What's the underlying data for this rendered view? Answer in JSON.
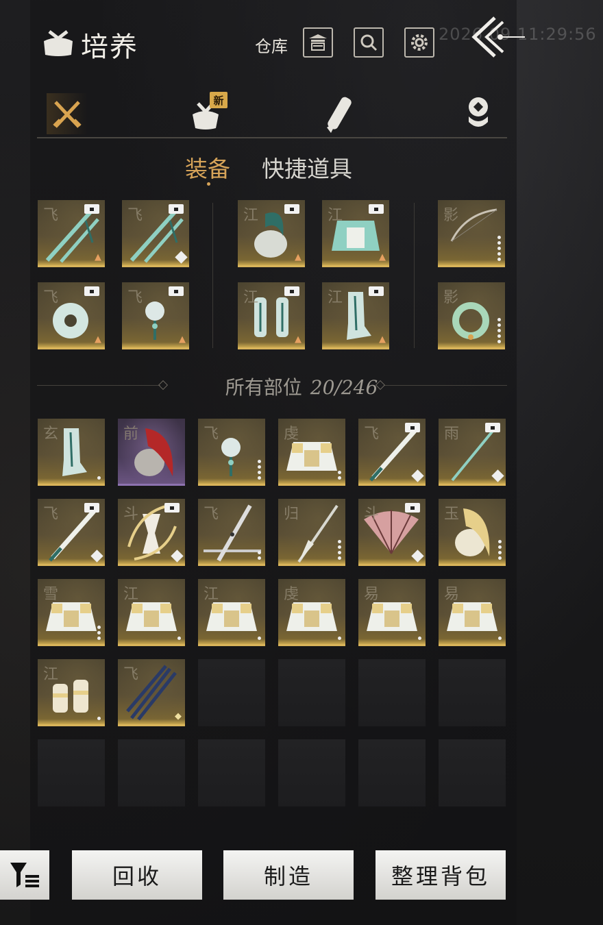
{
  "header": {
    "title": "培养",
    "warehouse_label": "仓库",
    "clock": "2026 09 11:29:56",
    "icons": [
      "bundle-icon",
      "warehouse-icon",
      "search-icon",
      "gear-icon",
      "back-arrow-icon"
    ]
  },
  "category_tabs": [
    {
      "icon": "crossed-swords-icon",
      "selected": true
    },
    {
      "icon": "bundle-icon",
      "badge": "新"
    },
    {
      "icon": "scroll-icon"
    },
    {
      "icon": "coin-stack-icon"
    }
  ],
  "sub_tabs": {
    "equipment": "装备",
    "quick_items": "快捷道具"
  },
  "equipped": [
    {
      "char": "飞",
      "item": "twin-jade-swords",
      "arrow": true
    },
    {
      "char": "飞",
      "item": "twin-jade-swords",
      "gem": true
    },
    {
      "char": "江",
      "item": "plumed-helmet",
      "arrow": true
    },
    {
      "char": "江",
      "item": "jade-chestplate",
      "arrow": true
    },
    {
      "char": "影",
      "item": "bow",
      "dots": 5
    },
    {
      "char": "飞",
      "item": "jade-disc",
      "arrow": true
    },
    {
      "char": "飞",
      "item": "jade-pendant",
      "arrow": true
    },
    {
      "char": "江",
      "item": "leg-guards",
      "arrow": true
    },
    {
      "char": "江",
      "item": "greaves",
      "arrow": true
    },
    {
      "char": "影",
      "item": "jade-ring",
      "dots": 5
    }
  ],
  "inventory": {
    "label": "所有部位",
    "count": "20/246",
    "items": [
      {
        "char": "玄",
        "item": "greaves",
        "dots": 1
      },
      {
        "char": "前",
        "item": "red-plume-helmet",
        "rarity": "purple"
      },
      {
        "char": "飞",
        "item": "jade-pendant",
        "dots": 4
      },
      {
        "char": "虔",
        "item": "gold-armor",
        "dots": 2
      },
      {
        "char": "飞",
        "item": "jade-sword",
        "gem": true
      },
      {
        "char": "雨",
        "item": "jade-spear",
        "gem": true
      },
      {
        "char": "飞",
        "item": "jade-sword",
        "gem": true
      },
      {
        "char": "斗",
        "item": "drum-weapon",
        "gem": true
      },
      {
        "char": "飞",
        "item": "spear-staff",
        "dots": 2
      },
      {
        "char": "归",
        "item": "glaive",
        "dots": 4
      },
      {
        "char": "斗",
        "item": "folding-fan",
        "gem": true
      },
      {
        "char": "玉",
        "item": "gold-plume-helmet",
        "dots": 4
      },
      {
        "char": "雪",
        "item": "gold-armor",
        "dots": 3
      },
      {
        "char": "江",
        "item": "gold-armor",
        "dots": 1
      },
      {
        "char": "江",
        "item": "gold-armor",
        "dots": 1
      },
      {
        "char": "虔",
        "item": "gold-armor",
        "dots": 1
      },
      {
        "char": "易",
        "item": "gold-armor",
        "dots": 1
      },
      {
        "char": "易",
        "item": "gold-armor",
        "dots": 1
      },
      {
        "char": "江",
        "item": "gold-gauntlets",
        "dots": 1
      },
      {
        "char": "飞",
        "item": "umbrella-blades",
        "diamond": true
      }
    ]
  },
  "buttons": {
    "recycle": "回收",
    "craft": "制造",
    "sort": "整理背包"
  }
}
